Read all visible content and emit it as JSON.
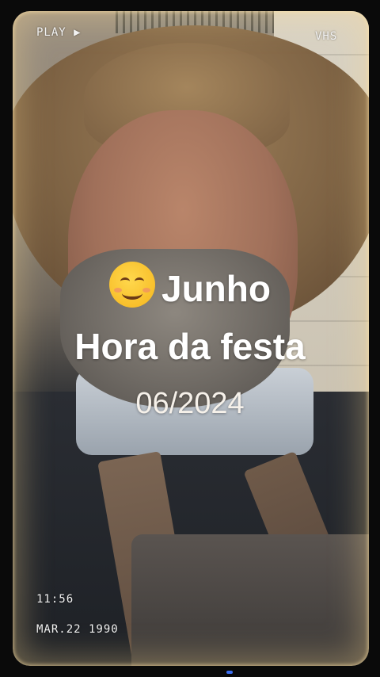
{
  "overlay": {
    "play_label": "PLAY ▶",
    "vhs_label": "VHS",
    "time": "11:56",
    "date": "MAR.22 1990"
  },
  "caption": {
    "emoji": "smiling-face-icon",
    "line1": "Junho",
    "line2": "Hora da festa",
    "line3": "06/2024"
  },
  "colors": {
    "caption_text": "#ffffff",
    "frame_glow": "#ffdc96"
  }
}
